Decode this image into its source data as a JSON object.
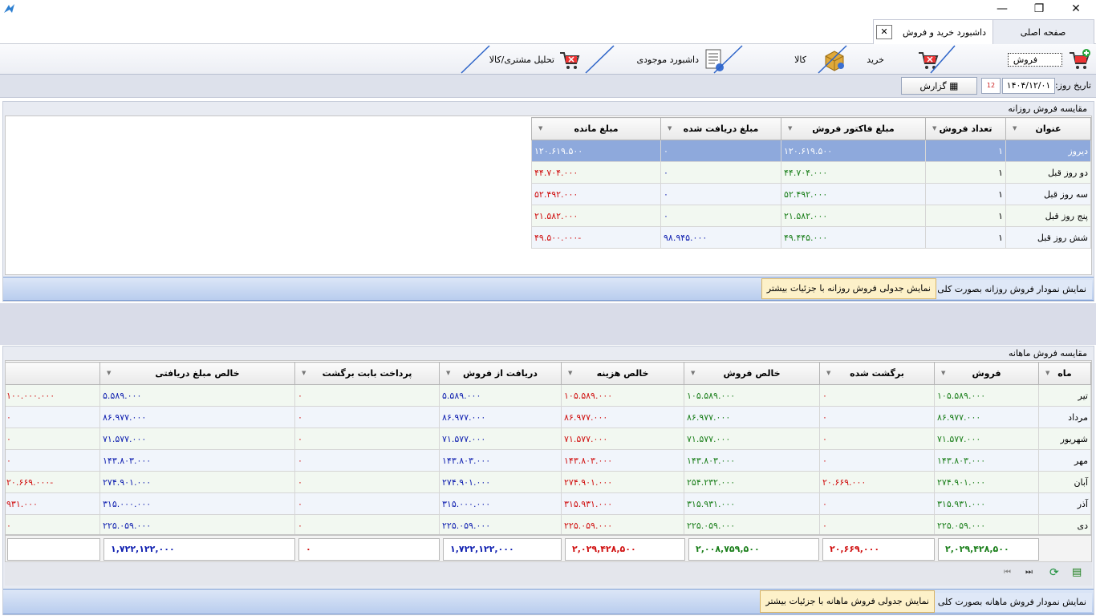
{
  "window": {
    "minimize": "—",
    "restore": "❐",
    "close": "✕"
  },
  "tabs": [
    {
      "label": "صفحه اصلی"
    },
    {
      "label": "داشبورد خرید و فروش",
      "close": "✕"
    }
  ],
  "ribbon": [
    {
      "label": "فروش",
      "icon": "cart-add-icon"
    },
    {
      "label": "خرید",
      "icon": "cart-icon"
    },
    {
      "label": "کالا",
      "icon": "package-icon"
    },
    {
      "label": "داشبورد موجودی",
      "icon": "document-icon"
    },
    {
      "label": "تحلیل مشتری/کالا",
      "icon": "cart-icon"
    }
  ],
  "datebar": {
    "label": "تاریخ روز:",
    "date": "۱۴۰۴/۱۲/۰۱",
    "calendar_day": "12",
    "report_label": "گزارش"
  },
  "daily": {
    "title": "مقایسه فروش روزانه",
    "headers": [
      "عنوان",
      "تعداد فروش",
      "مبلغ فاکتور فروش",
      "مبلغ دریافت شده",
      "مبلغ مانده"
    ],
    "rows": [
      {
        "title": "دیروز",
        "count": "۱",
        "invoice": "۱۲۰.۶۱۹.۵۰۰",
        "received": "۰",
        "remaining": "۱۲۰.۶۱۹.۵۰۰"
      },
      {
        "title": "دو روز قبل",
        "count": "۱",
        "invoice": "۴۴.۷۰۴.۰۰۰",
        "received": "۰",
        "remaining": "۴۴.۷۰۴.۰۰۰"
      },
      {
        "title": "سه روز قبل",
        "count": "۱",
        "invoice": "۵۲.۴۹۲.۰۰۰",
        "received": "۰",
        "remaining": "۵۲.۴۹۲.۰۰۰"
      },
      {
        "title": "پنج روز قبل",
        "count": "۱",
        "invoice": "۲۱.۵۸۲.۰۰۰",
        "received": "۰",
        "remaining": "۲۱.۵۸۲.۰۰۰"
      },
      {
        "title": "شش روز قبل",
        "count": "۱",
        "invoice": "۴۹.۴۴۵.۰۰۰",
        "received": "۹۸.۹۴۵.۰۰۰",
        "remaining": "۴۹.۵۰۰.۰۰۰-"
      }
    ],
    "btn_chart": "نمایش نمودار فروش روزانه بصورت کلی",
    "btn_table": "نمایش جدولی فروش روزانه با جزئیات بیشتر"
  },
  "monthly": {
    "title": "مقایسه فروش ماهانه",
    "headers": [
      "ماه",
      "فروش",
      "برگشت شده",
      "خالص فروش",
      "خالص هزینه",
      "دریافت از فروش",
      "پرداخت بابت برگشت",
      "خالص مبلغ دریافتی",
      ""
    ],
    "rows": [
      {
        "month": "تیر",
        "sales": "۱۰۵.۵۸۹.۰۰۰",
        "returned": "۰",
        "net_sales": "۱۰۵.۵۸۹.۰۰۰",
        "net_cost": "۱۰۵.۵۸۹.۰۰۰",
        "received": "۵.۵۸۹.۰۰۰",
        "refund": "۰",
        "net_received": "۵.۵۸۹.۰۰۰",
        "last": "۱۰۰.۰۰۰.۰۰۰"
      },
      {
        "month": "مرداد",
        "sales": "۸۶.۹۷۷.۰۰۰",
        "returned": "۰",
        "net_sales": "۸۶.۹۷۷.۰۰۰",
        "net_cost": "۸۶.۹۷۷.۰۰۰",
        "received": "۸۶.۹۷۷.۰۰۰",
        "refund": "۰",
        "net_received": "۸۶.۹۷۷.۰۰۰",
        "last": "۰"
      },
      {
        "month": "شهریور",
        "sales": "۷۱.۵۷۷.۰۰۰",
        "returned": "۰",
        "net_sales": "۷۱.۵۷۷.۰۰۰",
        "net_cost": "۷۱.۵۷۷.۰۰۰",
        "received": "۷۱.۵۷۷.۰۰۰",
        "refund": "۰",
        "net_received": "۷۱.۵۷۷.۰۰۰",
        "last": "۰"
      },
      {
        "month": "مهر",
        "sales": "۱۴۳.۸۰۳.۰۰۰",
        "returned": "۰",
        "net_sales": "۱۴۳.۸۰۳.۰۰۰",
        "net_cost": "۱۴۳.۸۰۳.۰۰۰",
        "received": "۱۴۳.۸۰۳.۰۰۰",
        "refund": "۰",
        "net_received": "۱۴۳.۸۰۳.۰۰۰",
        "last": "۰"
      },
      {
        "month": "آبان",
        "sales": "۲۷۴.۹۰۱.۰۰۰",
        "returned": "۲۰.۶۶۹.۰۰۰",
        "net_sales": "۲۵۴.۲۳۲.۰۰۰",
        "net_cost": "۲۷۴.۹۰۱.۰۰۰",
        "received": "۲۷۴.۹۰۱.۰۰۰",
        "refund": "۰",
        "net_received": "۲۷۴.۹۰۱.۰۰۰",
        "last": "۲۰.۶۶۹.۰۰۰-"
      },
      {
        "month": "آذر",
        "sales": "۳۱۵.۹۳۱.۰۰۰",
        "returned": "۰",
        "net_sales": "۳۱۵.۹۳۱.۰۰۰",
        "net_cost": "۳۱۵.۹۳۱.۰۰۰",
        "received": "۳۱۵.۰۰۰.۰۰۰",
        "refund": "۰",
        "net_received": "۳۱۵.۰۰۰.۰۰۰",
        "last": "۹۳۱.۰۰۰"
      },
      {
        "month": "دی",
        "sales": "۲۲۵.۰۵۹.۰۰۰",
        "returned": "۰",
        "net_sales": "۲۲۵.۰۵۹.۰۰۰",
        "net_cost": "۲۲۵.۰۵۹.۰۰۰",
        "received": "۲۲۵.۰۵۹.۰۰۰",
        "refund": "۰",
        "net_received": "۲۲۵.۰۵۹.۰۰۰",
        "last": "۰"
      }
    ],
    "totals": {
      "sales": "۲,۰۲۹,۴۲۸,۵۰۰",
      "returned": "۲۰,۶۶۹,۰۰۰",
      "net_sales": "۲,۰۰۸,۷۵۹,۵۰۰",
      "net_cost": "۲,۰۲۹,۴۲۸,۵۰۰",
      "received": "۱,۷۲۲,۱۲۲,۰۰۰",
      "refund": "۰",
      "net_received": "۱,۷۲۲,۱۲۲,۰۰۰"
    },
    "btn_chart": "نمایش نمودار فروش ماهانه بصورت کلی",
    "btn_table": "نمایش جدولی فروش ماهانه با جزئیات بیشتر"
  }
}
